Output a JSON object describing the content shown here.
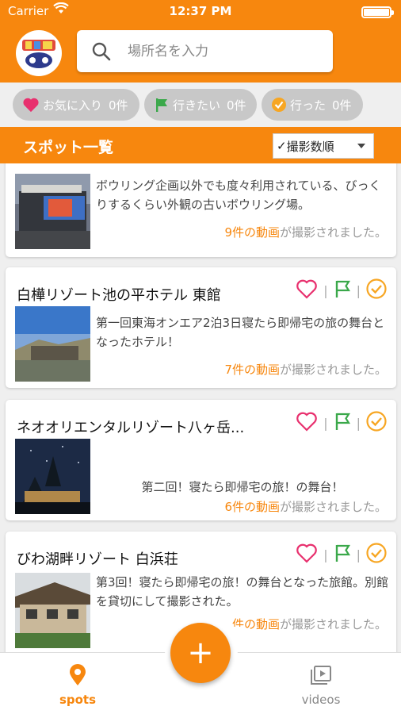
{
  "status": {
    "carrier": "Carrier",
    "time": "12:37 PM"
  },
  "search": {
    "placeholder": "場所名を入力"
  },
  "filters": [
    {
      "label": "お気に入り",
      "count": "0件",
      "icon": "heart-icon"
    },
    {
      "label": "行きたい",
      "count": "0件",
      "icon": "flag-icon"
    },
    {
      "label": "行った",
      "count": "0件",
      "icon": "check-circle-icon"
    }
  ],
  "list": {
    "title": "スポット一覧",
    "sort_value": "撮影数順"
  },
  "spots": [
    {
      "name": "",
      "desc": "ボウリング企画以外でも度々利用されている、びっくりするくらい外観の古いボウリング場。",
      "video_link": "9件の動画",
      "video_suffix": "が撮影されました。"
    },
    {
      "name": "白樺リゾート池の平ホテル 東館",
      "desc": "第一回東海オンエア2泊3日寝たら即帰宅の旅の舞台となったホテル！",
      "video_link": "7件の動画",
      "video_suffix": "が撮影されました。"
    },
    {
      "name": "ネオオリエンタルリゾート八ヶ岳...",
      "desc": "第二回！寝たら即帰宅の旅！の舞台！",
      "video_link": "6件の動画",
      "video_suffix": "が撮影されました。"
    },
    {
      "name": "びわ湖畔リゾート 白浜荘",
      "desc": "第3回！寝たら即帰宅の旅！の舞台となった旅館。別館を貸切にして撮影された。",
      "video_link": "件の動画",
      "video_suffix": "が撮影されました。"
    }
  ],
  "tabs": {
    "spots": "spots",
    "videos": "videos",
    "add": "+"
  },
  "colors": {
    "accent": "#f7870e",
    "heart": "#e8306e",
    "flag": "#3aa84a",
    "check": "#f7a623"
  }
}
